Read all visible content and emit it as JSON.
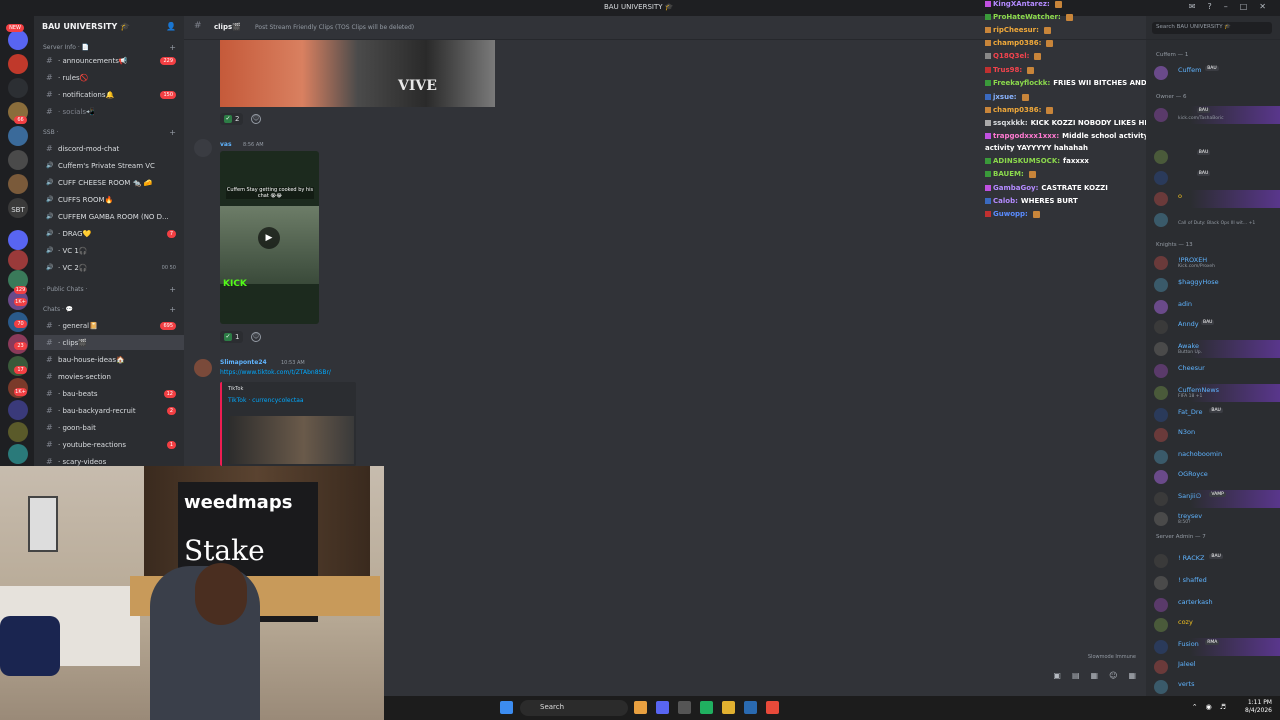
{
  "window": {
    "title": "BAU UNIVERSITY 🎓"
  },
  "server": {
    "name": "BAU UNIVERSITY 🎓"
  },
  "rail": {
    "new_badge": "NEW",
    "badges": [
      "66",
      "129",
      "1K+",
      "70",
      "23",
      "17",
      "1K+"
    ],
    "sbt": "SBT",
    "ssb": "SSB"
  },
  "channels": [
    {
      "kind": "cat",
      "label": "Server Info · 📄"
    },
    {
      "kind": "text",
      "label": "· announcements📢",
      "badge": "229"
    },
    {
      "kind": "text",
      "label": "· rules🚫"
    },
    {
      "kind": "text",
      "label": "· notifications🔔",
      "badge": "150"
    },
    {
      "kind": "text",
      "label": "· socials📲",
      "muted": true
    },
    {
      "kind": "cat",
      "label": "SSB ·"
    },
    {
      "kind": "text",
      "label": "discord-mod-chat"
    },
    {
      "kind": "voice",
      "label": "Cuffem's Private Stream VC"
    },
    {
      "kind": "voice",
      "label": "CUFF CHEESE ROOM 🐀 🧀"
    },
    {
      "kind": "voice",
      "label": "CUFFS ROOM🔥"
    },
    {
      "kind": "voice",
      "label": "CUFFEM GAMBA ROOM (NO D..."
    },
    {
      "kind": "voice",
      "label": "· DRAG💛",
      "badge": "7"
    },
    {
      "kind": "voice",
      "label": "· VC 1🎧"
    },
    {
      "kind": "voice",
      "label": "· VC 2🎧",
      "vc": "00 50"
    },
    {
      "kind": "cat",
      "label": "· Public Chats ·"
    },
    {
      "kind": "cat",
      "label": "Chats · 💬"
    },
    {
      "kind": "text",
      "label": "· general📔",
      "badge": "695"
    },
    {
      "kind": "text",
      "label": "· clips🎬",
      "selected": true
    },
    {
      "kind": "text",
      "label": "bau-house-ideas🏠"
    },
    {
      "kind": "text",
      "label": "movies-section"
    },
    {
      "kind": "text",
      "label": "· bau-beats",
      "badge": "12"
    },
    {
      "kind": "text",
      "label": "· bau-backyard-recruit",
      "badge": "2"
    },
    {
      "kind": "text",
      "label": "· goon-bait"
    },
    {
      "kind": "text",
      "label": "· youtube-reactions",
      "badge": "1"
    },
    {
      "kind": "text",
      "label": "· scary-videos"
    }
  ],
  "chat": {
    "channel_name": "clips🎬",
    "topic": "Post Stream Friendly Clips (TOS Clips will be deleted)",
    "reaction1_count": "2",
    "msg2_author": "vas",
    "msg2_time": "8:56 AM",
    "video_caption": "Cuffem Stay getting cooked by his chat 😭😂",
    "video_overlay": "KICK",
    "reaction2_count": "1",
    "msg3_author": "Slimaponte24",
    "msg3_time": "10:53 AM",
    "msg3_link": "https://www.tiktok.com/t/ZTAbn8SBr/",
    "embed_provider": "TikTok",
    "embed_title": "TikTok · currencycolectaa",
    "slowmode": "Slowmode Immune"
  },
  "twitch": [
    {
      "user": "KingXAntarez:",
      "color": "#b48bff",
      "text": ""
    },
    {
      "user": "ProHateWatcher:",
      "color": "#8bd94c",
      "text": ""
    },
    {
      "user": "ripCheesur:",
      "color": "#f0a93a",
      "text": ""
    },
    {
      "user": "champ0386:",
      "color": "#f0a93a",
      "text": ""
    },
    {
      "user": "Q18Q3el:",
      "color": "#f2434d",
      "text": ""
    },
    {
      "user": "Trus98:",
      "color": "#f2434d",
      "text": ""
    },
    {
      "user": "Freekayflockk:",
      "color": "#8bd94c",
      "text": "FRIES WII BITCHES AND BOTTLES IS BETTER"
    },
    {
      "user": "jxsue:",
      "color": "#8ab4ff",
      "text": ""
    },
    {
      "user": "champ0386:",
      "color": "#f0a93a",
      "text": ""
    },
    {
      "user": "ssqxkkk:",
      "color": "#dbdee1",
      "text": "KICK KOZZI NOBODY LIKES HIM"
    },
    {
      "user": "trapgodxxx1xxx:",
      "color": "#ff7ad1",
      "text": "Middle school activity YAYYYYY hahahahMiddle school"
    },
    {
      "user": "",
      "color": "#fff",
      "text": "activity YAYYYYY hahahah"
    },
    {
      "user": "ADINSKUMSOCK:",
      "color": "#8bd94c",
      "text": "faxxxx"
    },
    {
      "user": "BAUEM:",
      "color": "#8bd94c",
      "text": ""
    },
    {
      "user": "GambaGoy:",
      "color": "#b48bff",
      "text": "CASTRATE KOZZI"
    },
    {
      "user": "Calob:",
      "color": "#b48bff",
      "text": "WHERES BURT"
    },
    {
      "user": "Guwopp:",
      "color": "#5a8cff",
      "text": ""
    }
  ],
  "members": {
    "search_placeholder": "Search BAU UNIVERSITY 🎓",
    "groups": [
      {
        "title": "Cuffem — 1",
        "items": [
          {
            "name": "Cuffem",
            "color": "#5fb4ff",
            "tag": "BAU"
          }
        ]
      },
      {
        "title": "Owner — 6",
        "items": [
          {
            "name": "",
            "color": "#b48bff",
            "tag": "BAU",
            "sub": "kick.com/TashaBoric",
            "banner": true
          },
          {
            "name": "",
            "color": "#dbdee1",
            "tag": "BAU"
          },
          {
            "name": "",
            "color": "#dbdee1",
            "tag": "BAU"
          },
          {
            "name": "o",
            "color": "#f0c020",
            "tag": "",
            "banner": true
          },
          {
            "name": "",
            "color": "#dbdee1",
            "tag": "",
            "sub": "Call of Duty: Black Ops III wit... +1"
          }
        ]
      },
      {
        "title": "Knights — 13",
        "items": [
          {
            "name": "!PROXEH",
            "color": "#5fb4ff",
            "sub": "Kick.com/Proxeh"
          },
          {
            "name": "$haggyHose",
            "color": "#5fb4ff"
          },
          {
            "name": "adin",
            "color": "#5fb4ff"
          },
          {
            "name": "Anndy",
            "color": "#5fb4ff",
            "tag": "BAU"
          },
          {
            "name": "Awake",
            "color": "#5fb4ff",
            "sub": "Button Up.",
            "banner": true
          },
          {
            "name": "Cheesur",
            "color": "#5fb4ff"
          },
          {
            "name": "CuffemNews",
            "color": "#5fb4ff",
            "sub": "FIFA 18 +1",
            "banner": true
          },
          {
            "name": "Fat_Dre",
            "color": "#5fb4ff",
            "tag": "BAU"
          },
          {
            "name": "N3on",
            "color": "#5fb4ff"
          },
          {
            "name": "nachoboomin",
            "color": "#5fb4ff"
          },
          {
            "name": "OGRoyce",
            "color": "#5fb4ff"
          },
          {
            "name": "Sanjii∅",
            "color": "#5fb4ff",
            "tag": "VAMP",
            "banner": true
          },
          {
            "name": "treysev",
            "color": "#5fb4ff",
            "sub": "8:50?"
          }
        ]
      },
      {
        "title": "Server Admin — 7",
        "items": [
          {
            "name": "! RACKZ",
            "color": "#5fb4ff",
            "tag": "BAU"
          },
          {
            "name": "! shaffed",
            "color": "#5fb4ff"
          },
          {
            "name": "carterkash",
            "color": "#5fb4ff"
          },
          {
            "name": "cozy",
            "color": "#f0c020"
          },
          {
            "name": "Fusion",
            "color": "#5fb4ff",
            "tag": "RMA",
            "banner": true
          },
          {
            "name": "Jaleel",
            "color": "#5fb4ff"
          },
          {
            "name": "verts",
            "color": "#5fb4ff"
          }
        ]
      }
    ]
  },
  "webcam": {
    "brand1": "weedmaps",
    "brand2": "Stake"
  },
  "taskbar": {
    "search_label": "Search",
    "time": "1:11 PM",
    "date": "8/4/2026"
  },
  "colors": {
    "accent": "#5865f2",
    "bg_chat": "#313338",
    "bg_sidebar": "#2b2d31",
    "bg_rail": "#1e1f22",
    "link": "#00a8fc",
    "badge": "#f23f43"
  }
}
